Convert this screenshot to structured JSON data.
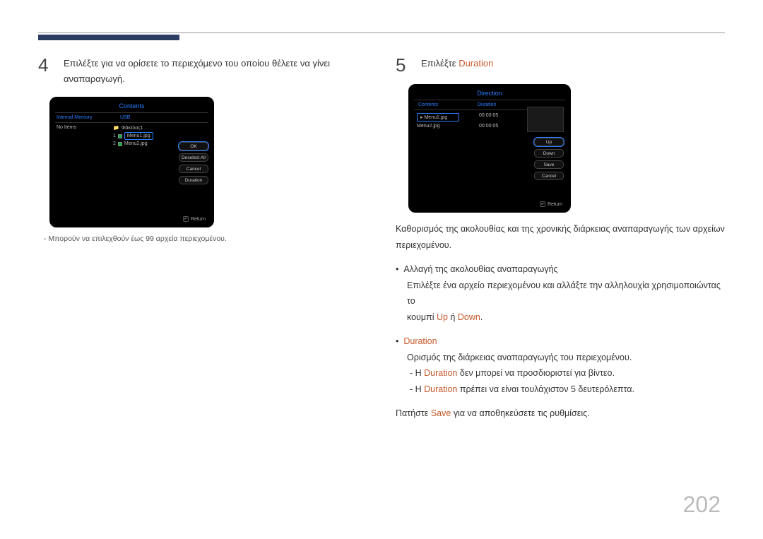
{
  "page_number": "202",
  "left": {
    "step_num": "4",
    "step_text_a": "Επιλέξτε  για να ορίσετε το περιεχόμενο του οποίου θέλετε να γίνει",
    "step_text_b": "αναπαραγωγή.",
    "note": "Μπορούν να επιλεχθούν έως 99 αρχεία περιεχομένου.",
    "device": {
      "title": "Contents",
      "col_a_header": "Internal Memory",
      "col_b_header": "USB",
      "col_a_rows": [
        "No Items"
      ],
      "col_b_rows": [
        {
          "idx": "",
          "name": "Φάκελος1",
          "check": false
        },
        {
          "idx": "1",
          "name": "Menu1.jpg",
          "check": true,
          "selected": true
        },
        {
          "idx": "2",
          "name": "Menu2.jpg",
          "check": true
        }
      ],
      "buttons": [
        "OK",
        "Deselect All",
        "Cancel",
        "Duration"
      ],
      "selected_button": "OK",
      "return_label": "Return"
    }
  },
  "right": {
    "step_num": "5",
    "step_text_a": "Επιλέξτε ",
    "step_highlight": "Duration",
    "device": {
      "title": "Direction",
      "col_a_header": "Contents",
      "col_b_header": "Duration",
      "rows": [
        {
          "name": "Menu1.jpg",
          "dur": "00:00:05",
          "selected": true
        },
        {
          "name": "Menu2.jpg",
          "dur": "00:00:05"
        }
      ],
      "buttons": [
        "Up",
        "Down",
        "Save",
        "Cancel"
      ],
      "selected_button": "Up",
      "return_label": "Return"
    },
    "para1": "Καθορισμός της ακολουθίας και της χρονικής διάρκειας αναπαραγωγής των αρχείων περιεχομένου.",
    "b1_prefix": "•",
    "b1_text": "Αλλαγή της ακολουθίας αναπαραγωγής",
    "b1_sub_a": "Επιλέξτε ένα αρχείο περιεχομένου και αλλάξτε την αλληλουχία χρησιμοποιώντας το",
    "b1_sub_b_a": "κουμπί ",
    "b1_sub_b_hl1": "Up",
    "b1_sub_b_mid": " ή ",
    "b1_sub_b_hl2": "Down",
    "b1_sub_b_end": ".",
    "b2_prefix": "•",
    "b2_hl": "Duration",
    "b2_sub": "Ορισμός της διάρκειας αναπαραγωγής του περιεχομένου.",
    "b2_d1_a": "Η ",
    "b2_d1_hl": "Duration",
    "b2_d1_b": " δεν μπορεί να προσδιοριστεί για βίντεο.",
    "b2_d2_a": "Η ",
    "b2_d2_hl": "Duration",
    "b2_d2_b": " πρέπει να είναι τουλάχιστον 5 δευτερόλεπτα.",
    "last_a": "Πατήστε ",
    "last_hl": "Save",
    "last_b": " για να αποθηκεύσετε τις ρυθμίσεις."
  }
}
